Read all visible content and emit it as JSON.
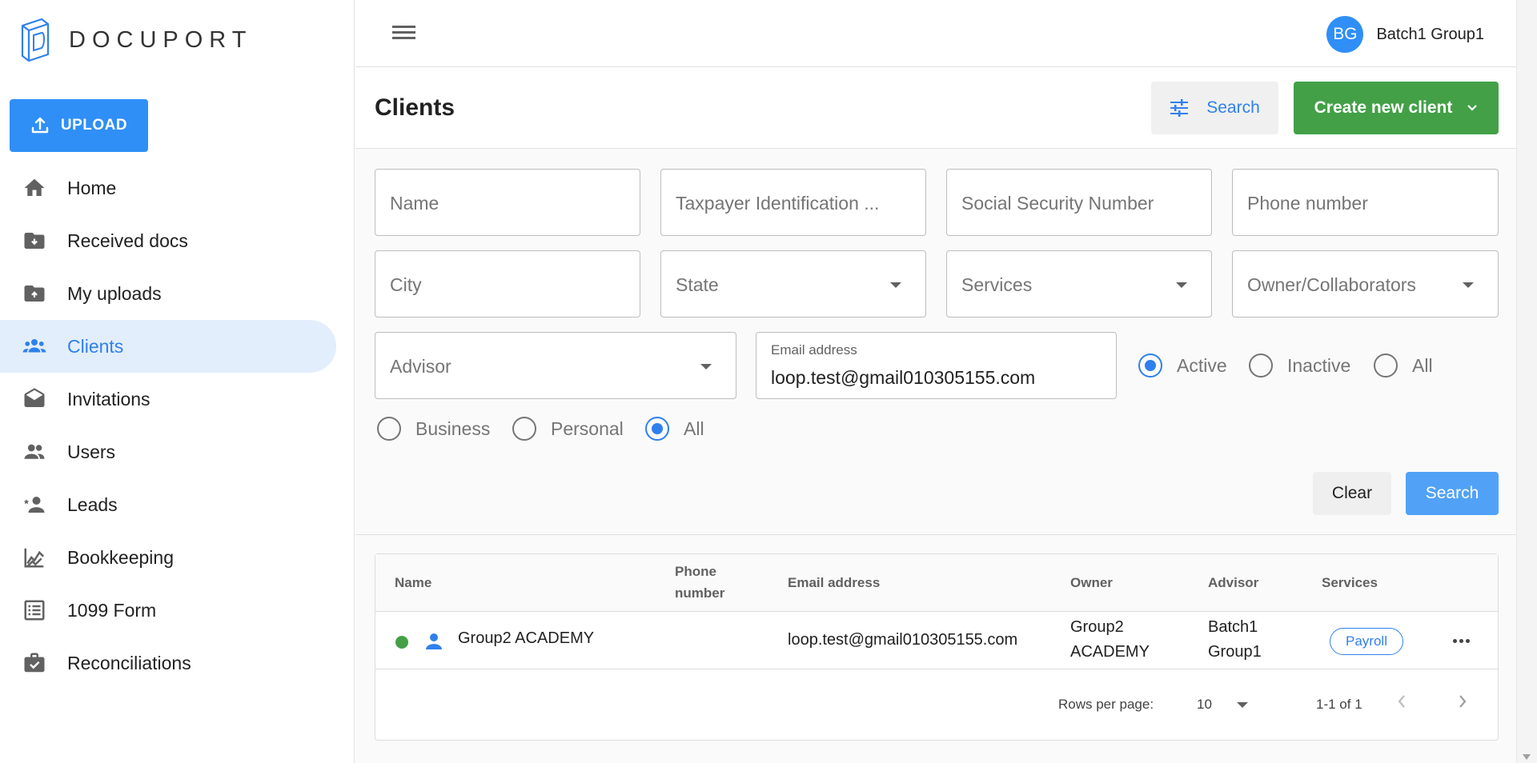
{
  "app": {
    "logo_text": "DOCUPORT"
  },
  "sidebar": {
    "upload_label": "UPLOAD",
    "items": [
      {
        "label": "Home",
        "icon": "home-icon",
        "active": false
      },
      {
        "label": "Received docs",
        "icon": "folder-download-icon",
        "active": false
      },
      {
        "label": "My uploads",
        "icon": "folder-upload-icon",
        "active": false
      },
      {
        "label": "Clients",
        "icon": "people-icon",
        "active": true
      },
      {
        "label": "Invitations",
        "icon": "envelope-open-icon",
        "active": false
      },
      {
        "label": "Users",
        "icon": "users-icon",
        "active": false
      },
      {
        "label": "Leads",
        "icon": "lead-star-person-icon",
        "active": false
      },
      {
        "label": "Bookkeeping",
        "icon": "chart-line-icon",
        "active": false
      },
      {
        "label": "1099 Form",
        "icon": "form-list-icon",
        "active": false
      },
      {
        "label": "Reconciliations",
        "icon": "briefcase-check-icon",
        "active": false
      }
    ]
  },
  "header": {
    "avatar_initials": "BG",
    "user_name": "Batch1 Group1"
  },
  "page": {
    "title": "Clients",
    "filter_button": "Search",
    "create_button": "Create new client"
  },
  "filters": {
    "name_placeholder": "Name",
    "tin_placeholder": "Taxpayer Identification ...",
    "ssn_placeholder": "Social Security Number",
    "phone_placeholder": "Phone number",
    "city_placeholder": "City",
    "state_placeholder": "State",
    "services_placeholder": "Services",
    "owner_placeholder": "Owner/Collaborators",
    "advisor_placeholder": "Advisor",
    "email_label": "Email address",
    "email_value": "loop.test@gmail010305155.com",
    "status_options": [
      "Active",
      "Inactive",
      "All"
    ],
    "status_selected": "Active",
    "type_options": [
      "Business",
      "Personal",
      "All"
    ],
    "type_selected": "All",
    "clear_label": "Clear",
    "search_label": "Search"
  },
  "table": {
    "headers": {
      "name": "Name",
      "phone_line1": "Phone",
      "phone_line2": "number",
      "email": "Email address",
      "owner": "Owner",
      "advisor": "Advisor",
      "services": "Services"
    },
    "rows": [
      {
        "status": "active",
        "status_color": "#43a047",
        "name": "Group2 ACADEMY",
        "phone": "",
        "email": "loop.test@gmail010305155.com",
        "owner_line1": "Group2",
        "owner_line2": "ACADEMY",
        "advisor_line1": "Batch1",
        "advisor_line2": "Group1",
        "service": "Payroll"
      }
    ],
    "pagination": {
      "rows_per_page_label": "Rows per page:",
      "rows_per_page": "10",
      "range": "1-1 of 1"
    }
  },
  "colors": {
    "primary": "#2f8ff7",
    "create": "#43a047",
    "active_nav_bg": "#e3eefc"
  }
}
